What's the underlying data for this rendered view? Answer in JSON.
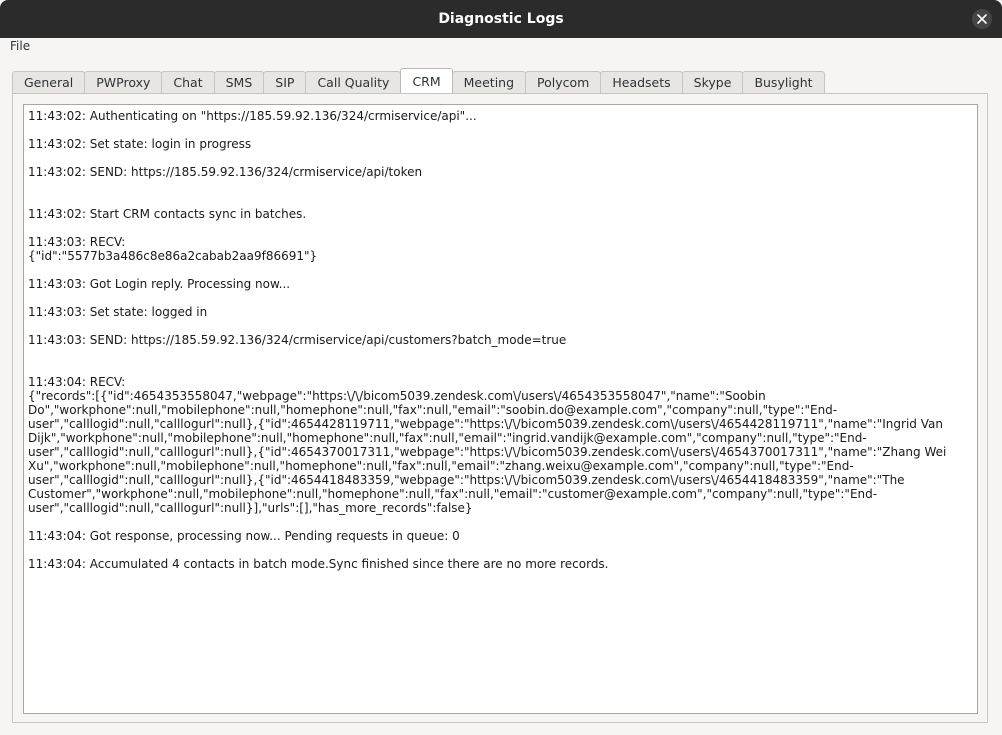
{
  "window": {
    "title": "Diagnostic Logs"
  },
  "menu": {
    "file": "File"
  },
  "tabs": [
    {
      "label": "General"
    },
    {
      "label": "PWProxy"
    },
    {
      "label": "Chat"
    },
    {
      "label": "SMS"
    },
    {
      "label": "SIP"
    },
    {
      "label": "Call Quality"
    },
    {
      "label": "CRM",
      "active": true
    },
    {
      "label": "Meeting"
    },
    {
      "label": "Polycom"
    },
    {
      "label": "Headsets"
    },
    {
      "label": "Skype"
    },
    {
      "label": "Busylight"
    }
  ],
  "log": {
    "text": "11:43:02: Authenticating on \"https://185.59.92.136/324/crmiservice/api\"...\n\n11:43:02: Set state: login in progress\n\n11:43:02: SEND: https://185.59.92.136/324/crmiservice/api/token\n\n\n11:43:02: Start CRM contacts sync in batches.\n\n11:43:03: RECV:\n{\"id\":\"5577b3a486c8e86a2cabab2aa9f86691\"}\n\n11:43:03: Got Login reply. Processing now...\n\n11:43:03: Set state: logged in\n\n11:43:03: SEND: https://185.59.92.136/324/crmiservice/api/customers?batch_mode=true\n\n\n11:43:04: RECV:\n{\"records\":[{\"id\":4654353558047,\"webpage\":\"https:\\/\\/bicom5039.zendesk.com\\/users\\/4654353558047\",\"name\":\"Soobin\nDo\",\"workphone\":null,\"mobilephone\":null,\"homephone\":null,\"fax\":null,\"email\":\"soobin.do@example.com\",\"company\":null,\"type\":\"End-\nuser\",\"calllogid\":null,\"calllogurl\":null},{\"id\":4654428119711,\"webpage\":\"https:\\/\\/bicom5039.zendesk.com\\/users\\/4654428119711\",\"name\":\"Ingrid Van\nDijk\",\"workphone\":null,\"mobilephone\":null,\"homephone\":null,\"fax\":null,\"email\":\"ingrid.vandijk@example.com\",\"company\":null,\"type\":\"End-\nuser\",\"calllogid\":null,\"calllogurl\":null},{\"id\":4654370017311,\"webpage\":\"https:\\/\\/bicom5039.zendesk.com\\/users\\/4654370017311\",\"name\":\"Zhang Wei\nXu\",\"workphone\":null,\"mobilephone\":null,\"homephone\":null,\"fax\":null,\"email\":\"zhang.weixu@example.com\",\"company\":null,\"type\":\"End-\nuser\",\"calllogid\":null,\"calllogurl\":null},{\"id\":4654418483359,\"webpage\":\"https:\\/\\/bicom5039.zendesk.com\\/users\\/4654418483359\",\"name\":\"The\nCustomer\",\"workphone\":null,\"mobilephone\":null,\"homephone\":null,\"fax\":null,\"email\":\"customer@example.com\",\"company\":null,\"type\":\"End-\nuser\",\"calllogid\":null,\"calllogurl\":null}],\"urls\":[],\"has_more_records\":false}\n\n11:43:04: Got response, processing now... Pending requests in queue: 0\n\n11:43:04: Accumulated 4 contacts in batch mode.Sync finished since there are no more records."
  }
}
